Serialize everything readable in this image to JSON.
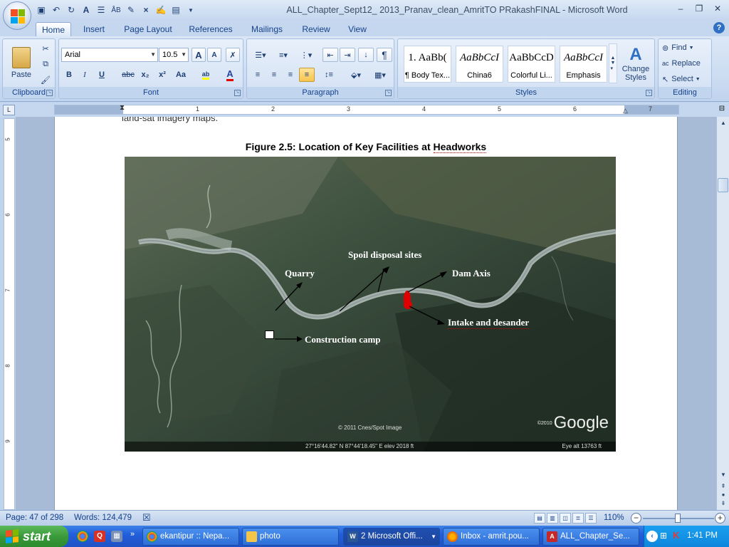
{
  "window": {
    "title": "ALL_Chapter_Sept12_ 2013_Pranav_clean_AmritTO PRakashFINAL - Microsoft Word",
    "minimize": "–",
    "restore": "❐",
    "close": "✕"
  },
  "qat": [
    "save-icon",
    "undo-icon",
    "redo-icon",
    "font-color-icon",
    "bullets-icon",
    "spelling-icon",
    "abc-icon",
    "close-doc-icon",
    "track-icon",
    "comment-icon"
  ],
  "tabs": [
    "Home",
    "Insert",
    "Page Layout",
    "References",
    "Mailings",
    "Review",
    "View"
  ],
  "active_tab": "Home",
  "help_label": "?",
  "ribbon": {
    "clipboard": {
      "label": "Clipboard",
      "paste": "Paste"
    },
    "font": {
      "label": "Font",
      "name": "Arial",
      "size": "10.5",
      "bold": "B",
      "italic": "I",
      "underline": "U",
      "strike": "abc",
      "subscript": "x₂",
      "superscript": "x²",
      "case": "Aa",
      "grow": "A",
      "shrink": "A"
    },
    "paragraph": {
      "label": "Paragraph",
      "pilcrow": "¶"
    },
    "styles": {
      "label": "Styles",
      "items": [
        {
          "sample": "1.  AaBb(",
          "name": "¶ Body Tex..."
        },
        {
          "sample": "AaBbCcI",
          "name": "China6"
        },
        {
          "sample": "AaBbCcD",
          "name": "Colorful Li..."
        },
        {
          "sample": "AaBbCcI",
          "name": "Emphasis"
        }
      ],
      "change_styles": "Change Styles"
    },
    "editing": {
      "label": "Editing",
      "find": "Find",
      "replace": "Replace",
      "select": "Select"
    }
  },
  "ruler": {
    "ticks": [
      "1",
      "2",
      "3",
      "4",
      "5",
      "6",
      "7"
    ]
  },
  "vruler": {
    "ticks": [
      "5",
      "6",
      "7",
      "8",
      "9"
    ]
  },
  "document": {
    "prev_text": "land-sat imagery  maps.",
    "caption_prefix": "Figure 2.5: Location of Key Facilities at ",
    "caption_squiggle": "Headworks",
    "map": {
      "labels": {
        "spoil": "Spoil disposal sites",
        "quarry": "Quarry",
        "dam": "Dam Axis",
        "intake": "Intake and desander",
        "camp": "Construction camp"
      },
      "copyright": "© 2011 Cnes/Spot Image",
      "google_year": "©2010",
      "google": "Google",
      "coords": "27°16'44.82\" N     87°44'18.45\" E     elev  2018 ft",
      "eye_alt": "Eye alt     13763 ft"
    }
  },
  "status": {
    "page": "Page: 47 of 298",
    "words": "Words: 124,479",
    "zoom": "110%",
    "zoom_minus": "−",
    "zoom_plus": "+"
  },
  "taskbar": {
    "start": "start",
    "tasks": [
      {
        "label": "ekantipur :: Nepa...",
        "icon": "chrome-icon"
      },
      {
        "label": "photo",
        "icon": "folder-icon"
      },
      {
        "label": "2 Microsoft Offi...",
        "icon": "word-icon",
        "active": true
      },
      {
        "label": "Inbox - amrit.pou...",
        "icon": "firefox-icon"
      },
      {
        "label": "ALL_Chapter_Se...",
        "icon": "pdf-icon"
      }
    ],
    "clock": "1:41 PM"
  },
  "colors": {
    "accent": "#15428b",
    "marker": "#e00000",
    "taskbar": "#245edb"
  }
}
